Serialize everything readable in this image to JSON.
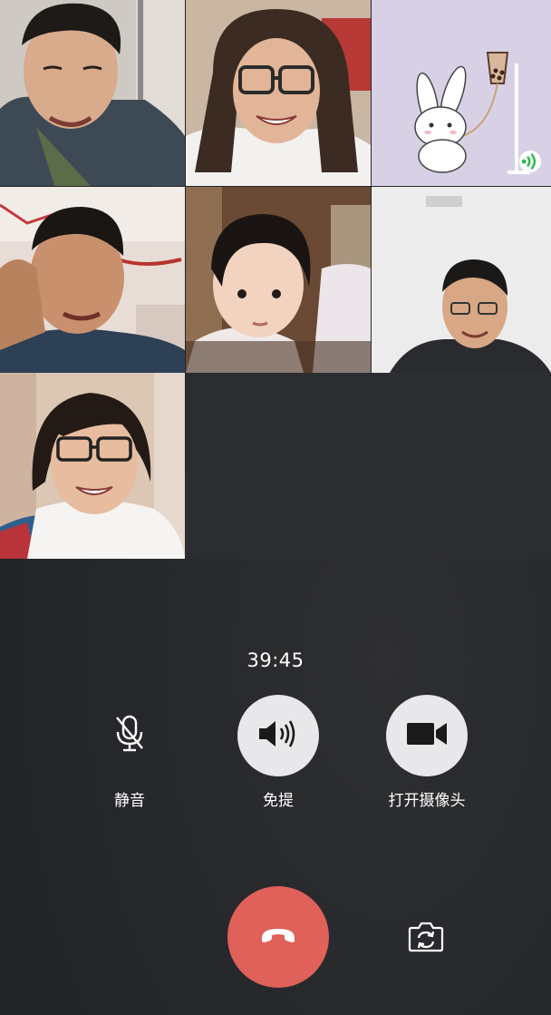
{
  "call": {
    "timer": "39:45"
  },
  "participants": [
    {
      "id": "p1",
      "type": "video"
    },
    {
      "id": "p2",
      "type": "video"
    },
    {
      "id": "p3",
      "type": "avatar",
      "speaking": true
    },
    {
      "id": "p4",
      "type": "video"
    },
    {
      "id": "p5",
      "type": "video"
    },
    {
      "id": "p6",
      "type": "video"
    },
    {
      "id": "p7",
      "type": "video"
    }
  ],
  "controls": {
    "mute_label": "静音",
    "speaker_label": "免提",
    "camera_label": "打开摄像头"
  },
  "icons": {
    "mute": "microphone-muted-icon",
    "speaker": "speaker-icon",
    "camera": "video-camera-icon",
    "hangup": "hang-up-icon",
    "switch_camera": "switch-camera-icon",
    "speaking": "speaking-indicator-icon"
  },
  "colors": {
    "hangup": "#e0605a",
    "control_button": "#e8e8ea",
    "speaking_indicator": "#2db84d",
    "avatar_background": "#d8d1e6"
  }
}
